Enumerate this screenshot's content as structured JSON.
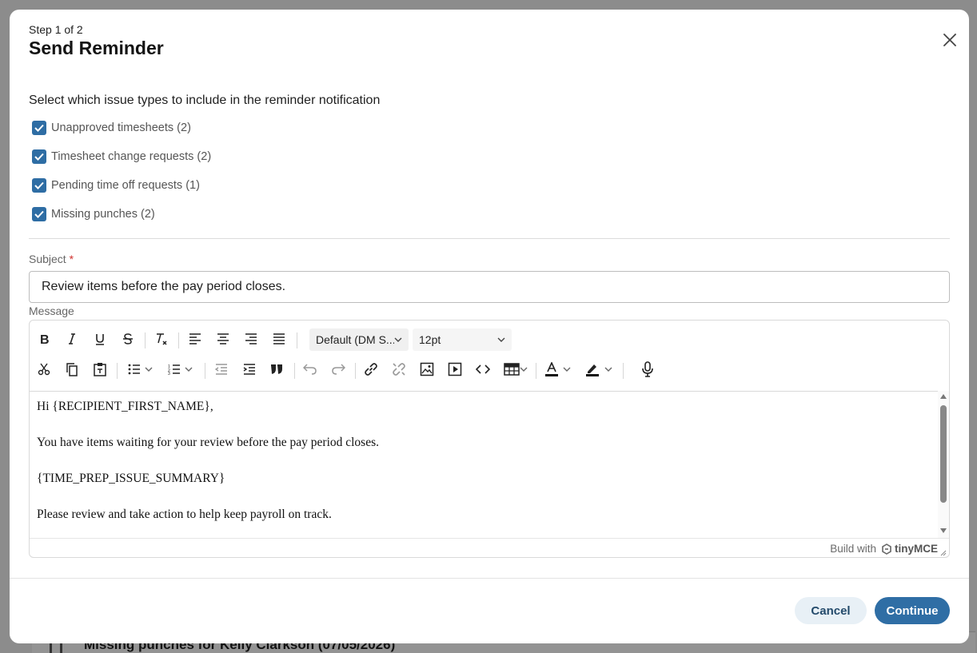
{
  "background": {
    "bottom_item": "Missing punches for Kelly Clarkson (07/05/2026)"
  },
  "modal": {
    "step": "Step 1 of 2",
    "title": "Send Reminder",
    "instruction": "Select which issue types to include in the reminder notification",
    "issue_types": [
      {
        "label": "Unapproved timesheets (2)",
        "checked": true
      },
      {
        "label": "Timesheet change requests (2)",
        "checked": true
      },
      {
        "label": "Pending time off requests (1)",
        "checked": true
      },
      {
        "label": "Missing punches (2)",
        "checked": true
      }
    ],
    "subject": {
      "label": "Subject",
      "required_mark": "*",
      "value": "Review items before the pay period closes."
    },
    "message": {
      "label": "Message",
      "font_family_value": "Default (DM S...",
      "font_size_value": "12pt",
      "paragraphs": [
        "Hi {RECIPIENT_FIRST_NAME},",
        "You have items waiting for your review before the pay period closes.",
        "{TIME_PREP_ISSUE_SUMMARY}",
        "Please review and take action to help keep payroll on track."
      ],
      "branding_prefix": "Build with",
      "branding_name": "tinyMCE"
    },
    "buttons": {
      "cancel": "Cancel",
      "continue": "Continue"
    }
  },
  "colors": {
    "primary": "#2f6ea5",
    "cancel_bg": "#e8f0f6",
    "required": "#d0322f"
  }
}
